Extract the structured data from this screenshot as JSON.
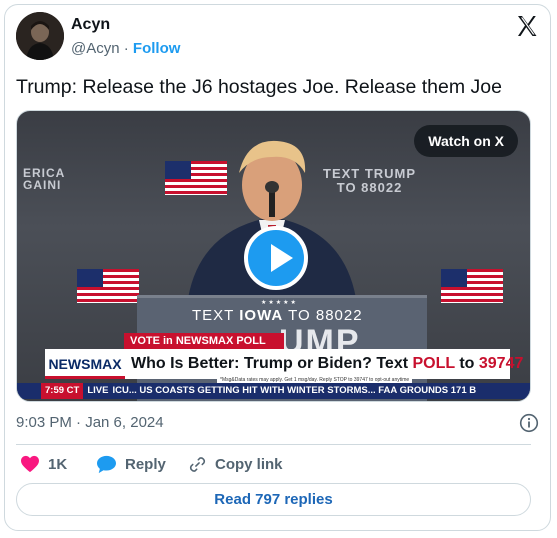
{
  "author": {
    "name": "Acyn",
    "handle": "@Acyn",
    "separator": "·",
    "follow_label": "Follow"
  },
  "tweet": {
    "text": "Trump: Release the J6 hostages Joe. Release them Joe"
  },
  "media": {
    "watch_label": "Watch on X",
    "bg_left": "ERICA\nGAINI",
    "bg_right": "TEXT TRUMP\nTO 88022",
    "podium_stars": "★★★★★",
    "podium_text_pre": "TEXT ",
    "podium_text_bold": "IOWA",
    "podium_text_post": " TO 88022",
    "vote_bar": "VOTE in NEWSMAX POLL",
    "logo": "NEWSMAX",
    "headline_pre": "Who Is Better: Trump or Biden? Text ",
    "headline_red": "POLL",
    "headline_mid": " to ",
    "headline_num": "39747",
    "fine_print": "*Msg&Data rates may apply. Get 1 msg/day. Reply STOP to 39747 to opt-out anytime",
    "ticker_time": "7:59 CT",
    "ticker_live": "LIVE",
    "ticker_text": "ICU...  US COASTS GETTING HIT WITH WINTER STORMS...  FAA GROUNDS 171 B",
    "ticker_left": "ERI\nAINI",
    "colors": {
      "play": "#1d9bf0",
      "newsmax_red": "#c8102e",
      "ticker_blue": "#1a2d6b"
    }
  },
  "meta": {
    "timestamp": "9:03 PM · Jan 6, 2024"
  },
  "actions": {
    "like_count": "1K",
    "reply_label": "Reply",
    "copy_label": "Copy link",
    "like_icon": "heart-icon",
    "reply_icon": "speech-bubble-icon",
    "copy_icon": "link-icon"
  },
  "read_replies": "Read 797 replies",
  "colors": {
    "accent": "#1d9bf0",
    "like": "#f91880",
    "muted": "#536471",
    "border": "#cfd9de"
  }
}
